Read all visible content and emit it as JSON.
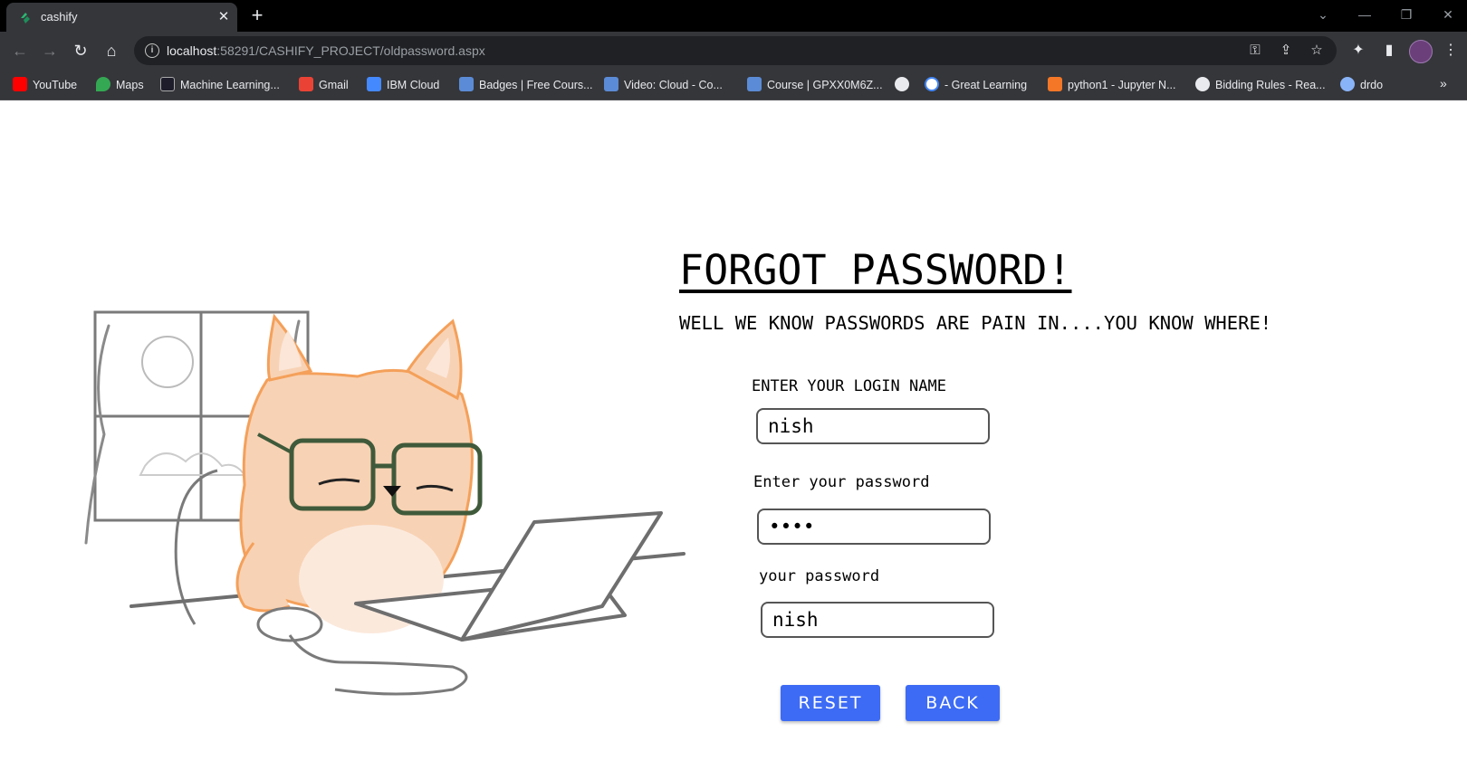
{
  "browser": {
    "tab": {
      "title": "cashify",
      "close_glyph": "✕"
    },
    "new_tab_glyph": "+",
    "url_host": "localhost",
    "url_rest": ":58291/CASHIFY_PROJECT/oldpassword.aspx",
    "bookmarks": [
      {
        "label": "YouTube",
        "icon": "youtube-icon",
        "color": "#ff0000"
      },
      {
        "label": "Maps",
        "icon": "maps-icon",
        "color": "#34a853"
      },
      {
        "label": "Machine Learning...",
        "icon": "ai-icon",
        "color": "#1d1d2b"
      },
      {
        "label": "Gmail",
        "icon": "gmail-icon",
        "color": "#ea4335"
      },
      {
        "label": "IBM Cloud",
        "icon": "ibm-cloud-icon",
        "color": "#4589ff"
      },
      {
        "label": "Badges | Free Cours...",
        "icon": "cognitive-class-icon",
        "color": "#5b8bd6"
      },
      {
        "label": "Video: Cloud  -  Co...",
        "icon": "cognitive-class-icon",
        "color": "#5b8bd6"
      },
      {
        "label": "Course | GPXX0M6Z...",
        "icon": "cognitive-class-icon",
        "color": "#5b8bd6"
      },
      {
        "label": "",
        "icon": "globe-icon",
        "color": "#e8eaed"
      },
      {
        "label": "- Great Learning",
        "icon": "google-icon",
        "color": "#4285f4"
      },
      {
        "label": "python1 - Jupyter N...",
        "icon": "jupyter-icon",
        "color": "#f37726"
      },
      {
        "label": "Bidding Rules - Rea...",
        "icon": "globe-icon",
        "color": "#e8eaed"
      },
      {
        "label": "drdo",
        "icon": "drdo-icon",
        "color": "#8ab4f8"
      }
    ],
    "bookmarks_overflow": "»"
  },
  "page": {
    "heading": "FORGOT PASSWORD!",
    "subtitle": "WELL WE KNOW PASSWORDS ARE PAIN IN....YOU KNOW WHERE!",
    "form": {
      "login_label": "ENTER YOUR LOGIN NAME",
      "login_value": "nish",
      "password_label": "Enter your password",
      "password_value": "nish",
      "confirm_label": "your password",
      "confirm_value": "nish",
      "reset_label": "RESET",
      "back_label": "BACK"
    }
  },
  "colors": {
    "accent_button": "#3d6bf5",
    "cat_fur": "#f6c8a8",
    "cat_outline": "#f4a05a",
    "glasses": "#3f5a3a"
  }
}
